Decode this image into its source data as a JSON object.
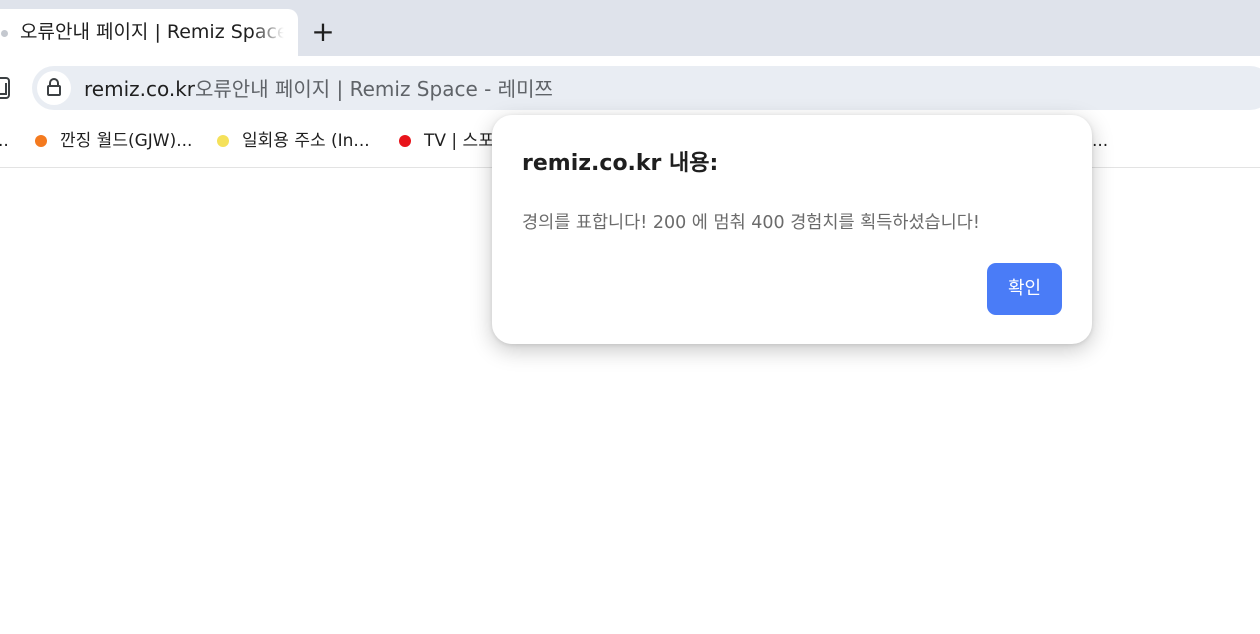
{
  "tab": {
    "title": "오류안내 페이지 | Remiz Space - 레미쯔",
    "new_tab_label": "+"
  },
  "toolbar": {
    "url_domain": "remiz.co.kr",
    "page_title": "오류안내 페이지 | Remiz Space - 레미쯔"
  },
  "bookmarks": {
    "leading_ellipsis": "..",
    "items": [
      {
        "label": "깐징 월드(GJW)...",
        "dot_color": "#f47a1f"
      },
      {
        "label": "일회용 주소 (In...",
        "dot_color": "#f5e15a"
      },
      {
        "label": "TV | 스포",
        "dot_color": "#e8141b"
      }
    ],
    "trailing_ellipsis": "..."
  },
  "dialog": {
    "title": "remiz.co.kr 내용:",
    "message": "경의를 표합니다! 200 에 멈춰 400 경험치를 획득하셨습니다!",
    "ok_label": "확인",
    "ok_color": "#4a7cf7"
  },
  "icons": {
    "tab_favicon": "dot-icon",
    "new_tab": "plus-icon",
    "side_panel": "side-panel-icon",
    "site_info": "lock-icon"
  }
}
